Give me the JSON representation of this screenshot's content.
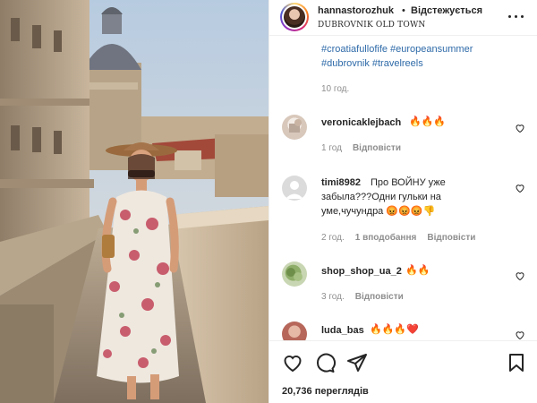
{
  "post": {
    "username": "hannastorozhuk",
    "separator": "•",
    "follow_label": "Відстежується",
    "location": "DUBROVNIK OLD TOWN",
    "more_icon": "more-horizontal-icon"
  },
  "caption": {
    "hashtags_line1": "#croatiafullofife #europeansummer",
    "hashtags_line2": "#dubrovnik #travelreels",
    "time": "10 год."
  },
  "comments": [
    {
      "username": "veronicaklejbach",
      "text": "🔥🔥🔥",
      "time": "1 год",
      "reply_label": "Відповісти"
    },
    {
      "username": "timi8982",
      "text_line1": "Про ВОЙНУ уже",
      "text_line2": "забыла???Одни гульки на",
      "text_line3": "уме,чучундра 😡😡😡👎",
      "time": "2 год.",
      "likes": "1 вподобання",
      "reply_label": "Відповісти"
    },
    {
      "username": "shop_shop_ua_2",
      "text": "🔥🔥",
      "time": "3 год.",
      "reply_label": "Відповісти"
    },
    {
      "username": "luda_bas",
      "text": "🔥🔥🔥❤️"
    }
  ],
  "footer": {
    "views": "20,736 переглядів"
  },
  "colors": {
    "hashtag": "#2e6aa8",
    "muted": "#8e8e8e",
    "text": "#262626"
  }
}
